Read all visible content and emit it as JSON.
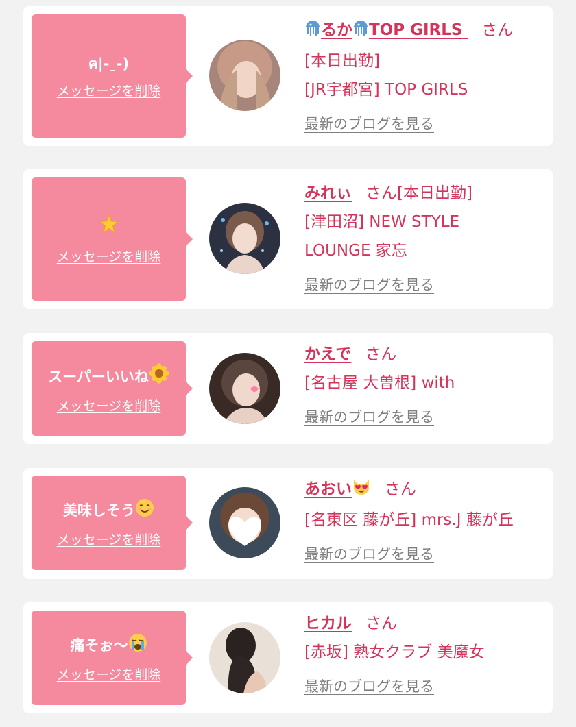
{
  "entries": [
    {
      "message": "ฅ|-ˍ-)",
      "delete_label": "メッセージを削除",
      "name_prefix_icon": "jellyfish-icon",
      "name": "るか",
      "name_middle_icon": "jellyfish-icon",
      "name_suffix": "TOP GIRLS",
      "honorific": "さん",
      "status": "[本日出勤]",
      "shop": "[JR宇都宮] TOP GIRLS",
      "blog_link": "最新のブログを見る"
    },
    {
      "message_icon": "sparkle-star-icon",
      "delete_label": "メッセージを削除",
      "name": "みれぃ",
      "honorific": "さん",
      "status": "[本日出勤]",
      "shop": "[津田沼] NEW STYLE LOUNGE 家忘",
      "blog_link": "最新のブログを見る"
    },
    {
      "message": "スーパーいいね",
      "message_icon": "sunflower-icon",
      "delete_label": "メッセージを削除",
      "name": "かえで",
      "honorific": "さん",
      "shop": "[名古屋 大曽根] with",
      "blog_link": "最新のブログを見る"
    },
    {
      "message": "美味しそう",
      "message_icon": "smiling-face-icon",
      "delete_label": "メッセージを削除",
      "name": "あおい",
      "name_icon": "heart-eyes-cat-icon",
      "honorific": "さん",
      "shop": "[名東区 藤が丘] mrs.J 藤が丘",
      "blog_link": "最新のブログを見る"
    },
    {
      "message": "痛そぉ〜",
      "message_icon": "crying-face-icon",
      "delete_label": "メッセージを削除",
      "name": "ヒカル",
      "honorific": "さん",
      "shop": "[赤坂] 熟女クラブ 美魔女",
      "blog_link": "最新のブログを見る"
    }
  ],
  "colors": {
    "bubble": "#f5899e",
    "accent_text": "#d6335a",
    "link_gray": "#7f7f7f",
    "background": "#f2f2f2"
  }
}
